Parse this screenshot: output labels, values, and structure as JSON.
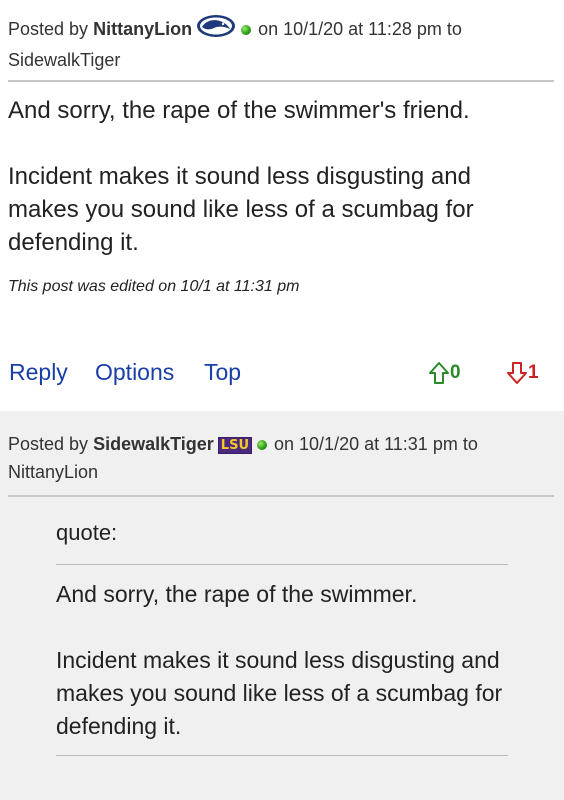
{
  "post1": {
    "posted_by": "Posted by",
    "username": "NittanyLion",
    "team_logo": "penn-state-logo",
    "meta_on": "on 10/1/20 at 11:28 pm to",
    "reply_to": "SidewalkTiger",
    "paragraph1": "And sorry, the rape of the swimmer's friend.",
    "paragraph2": "Incident makes it sound less disgusting and makes you sound like less of a scumbag for defending it.",
    "edited_note": "This post was edited on 10/1 at 11:31 pm",
    "actions": {
      "reply": "Reply",
      "options": "Options",
      "top": "Top"
    },
    "upvotes": "0",
    "downvotes": "1"
  },
  "post2": {
    "posted_by": "Posted by",
    "username": "SidewalkTiger",
    "team_logo": "LSU",
    "meta_on": "on 10/1/20 at 11:31 pm to",
    "reply_to": "NittanyLion",
    "quote_label": "quote:",
    "quote_paragraph1": "And sorry, the rape of the swimmer.",
    "quote_paragraph2": "Incident makes it sound less disgusting and makes you sound like less of a scumbag for defending it."
  },
  "colors": {
    "link_blue": "#1a3ea8",
    "upvote_green": "#2a8a2a",
    "downvote_red": "#cc2222",
    "online_green": "#2ea11a",
    "alt_row_bg": "#f0f0f0"
  }
}
